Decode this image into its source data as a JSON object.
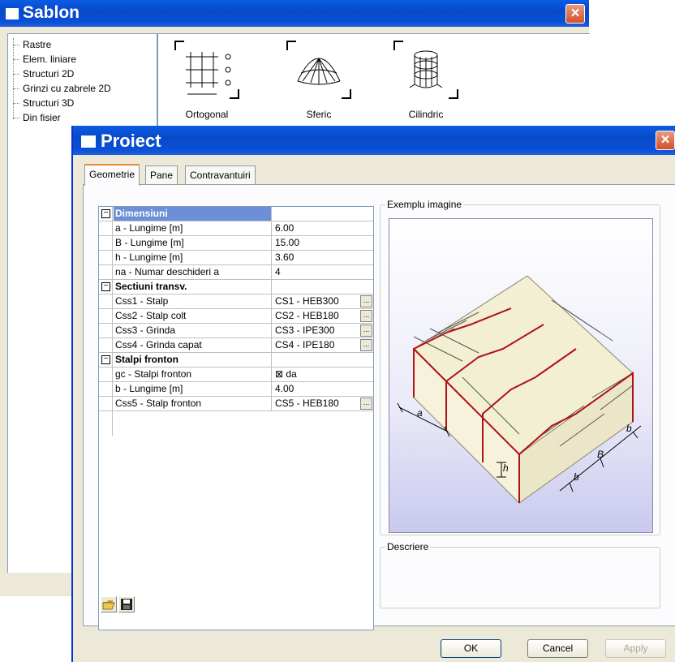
{
  "sablon": {
    "title": "Sablon",
    "close": "×",
    "tree": [
      "Rastre",
      "Elem. liniare",
      "Structuri 2D",
      "Grinzi cu zabrele 2D",
      "Structuri 3D",
      "Din fisier"
    ],
    "templates": [
      {
        "label": "Ortogonal",
        "icon": "orthogonal-grid-icon"
      },
      {
        "label": "Sferic",
        "icon": "spherical-dome-icon"
      },
      {
        "label": "Cilindric",
        "icon": "cylinder-icon"
      }
    ]
  },
  "proiect": {
    "title": "Proiect",
    "close": "×",
    "tabs": [
      "Geometrie",
      "Pane",
      "Contravantuiri"
    ],
    "active_tab": "Geometrie",
    "groups": {
      "dimensiuni": {
        "title": "Dimensiuni",
        "expander": "−",
        "rows": [
          {
            "name": "a - Lungime [m]",
            "value": "6.00"
          },
          {
            "name": "B - Lungime [m]",
            "value": "15.00"
          },
          {
            "name": "h - Lungime [m]",
            "value": "3.60"
          },
          {
            "name": "na - Numar deschideri a",
            "value": "4"
          }
        ]
      },
      "sectiuni": {
        "title": "Sectiuni transv.",
        "expander": "−",
        "rows": [
          {
            "name": "Css1 - Stalp",
            "value": "CS1 - HEB300"
          },
          {
            "name": "Css2 - Stalp colt",
            "value": "CS2 - HEB180"
          },
          {
            "name": "Css3 - Grinda",
            "value": "CS3 - IPE300"
          },
          {
            "name": "Css4 - Grinda capat",
            "value": "CS4 - IPE180"
          }
        ]
      },
      "stalpi": {
        "title": "Stalpi fronton",
        "expander": "−",
        "rows": [
          {
            "name": "gc - Stalpi fronton",
            "value": "⊠  da"
          },
          {
            "name": "b - Lungime [m]",
            "value": "4.00"
          },
          {
            "name": "Css5 - Stalp fronton",
            "value": "CS5 - HEB180"
          }
        ]
      }
    },
    "ellipsis": "...",
    "example_label": "Exemplu imagine",
    "description_label": "Descriere",
    "diagram_labels": {
      "a": "a",
      "h": "h",
      "b1": "b",
      "b2": "b",
      "B": "B"
    },
    "buttons": {
      "ok": "OK",
      "cancel": "Cancel",
      "apply": "Apply"
    },
    "toolbar_icons": [
      "open-folder-icon",
      "save-disk-icon"
    ]
  }
}
